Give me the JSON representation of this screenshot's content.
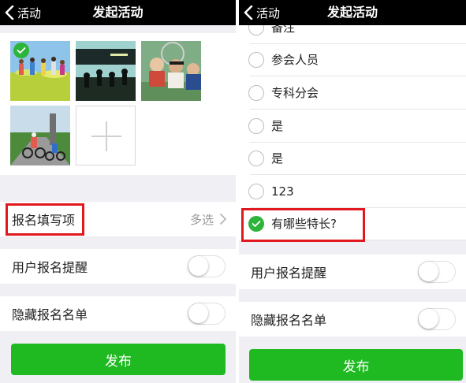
{
  "left": {
    "nav": {
      "back_label": "活动",
      "title": "发起活动"
    },
    "photos": {
      "count": 4
    },
    "signup_fields": {
      "label": "报名填写项",
      "value": "多选"
    },
    "signup_reminder": {
      "label": "用户报名提醒",
      "on": false
    },
    "hide_list": {
      "label": "隐藏报名名单",
      "on": false
    },
    "publish_label": "发布"
  },
  "right": {
    "nav": {
      "back_label": "活动",
      "title": "发起活动"
    },
    "options": [
      {
        "label": "备注",
        "checked": false
      },
      {
        "label": "参会人员",
        "checked": false
      },
      {
        "label": "专科分会",
        "checked": false
      },
      {
        "label": "是",
        "checked": false
      },
      {
        "label": "是",
        "checked": false
      },
      {
        "label": "123",
        "checked": false
      },
      {
        "label": "有哪些特长?",
        "checked": true
      }
    ],
    "signup_reminder": {
      "label": "用户报名提醒",
      "on": false
    },
    "hide_list": {
      "label": "隐藏报名名单",
      "on": false
    },
    "publish_label": "发布"
  },
  "colors": {
    "accent_green": "#1fb922",
    "check_green": "#2cb43b",
    "highlight_red": "#e0191f"
  },
  "icons": [
    "chevron-left-icon",
    "checkmark-icon",
    "plus-icon",
    "chevron-right-icon"
  ]
}
